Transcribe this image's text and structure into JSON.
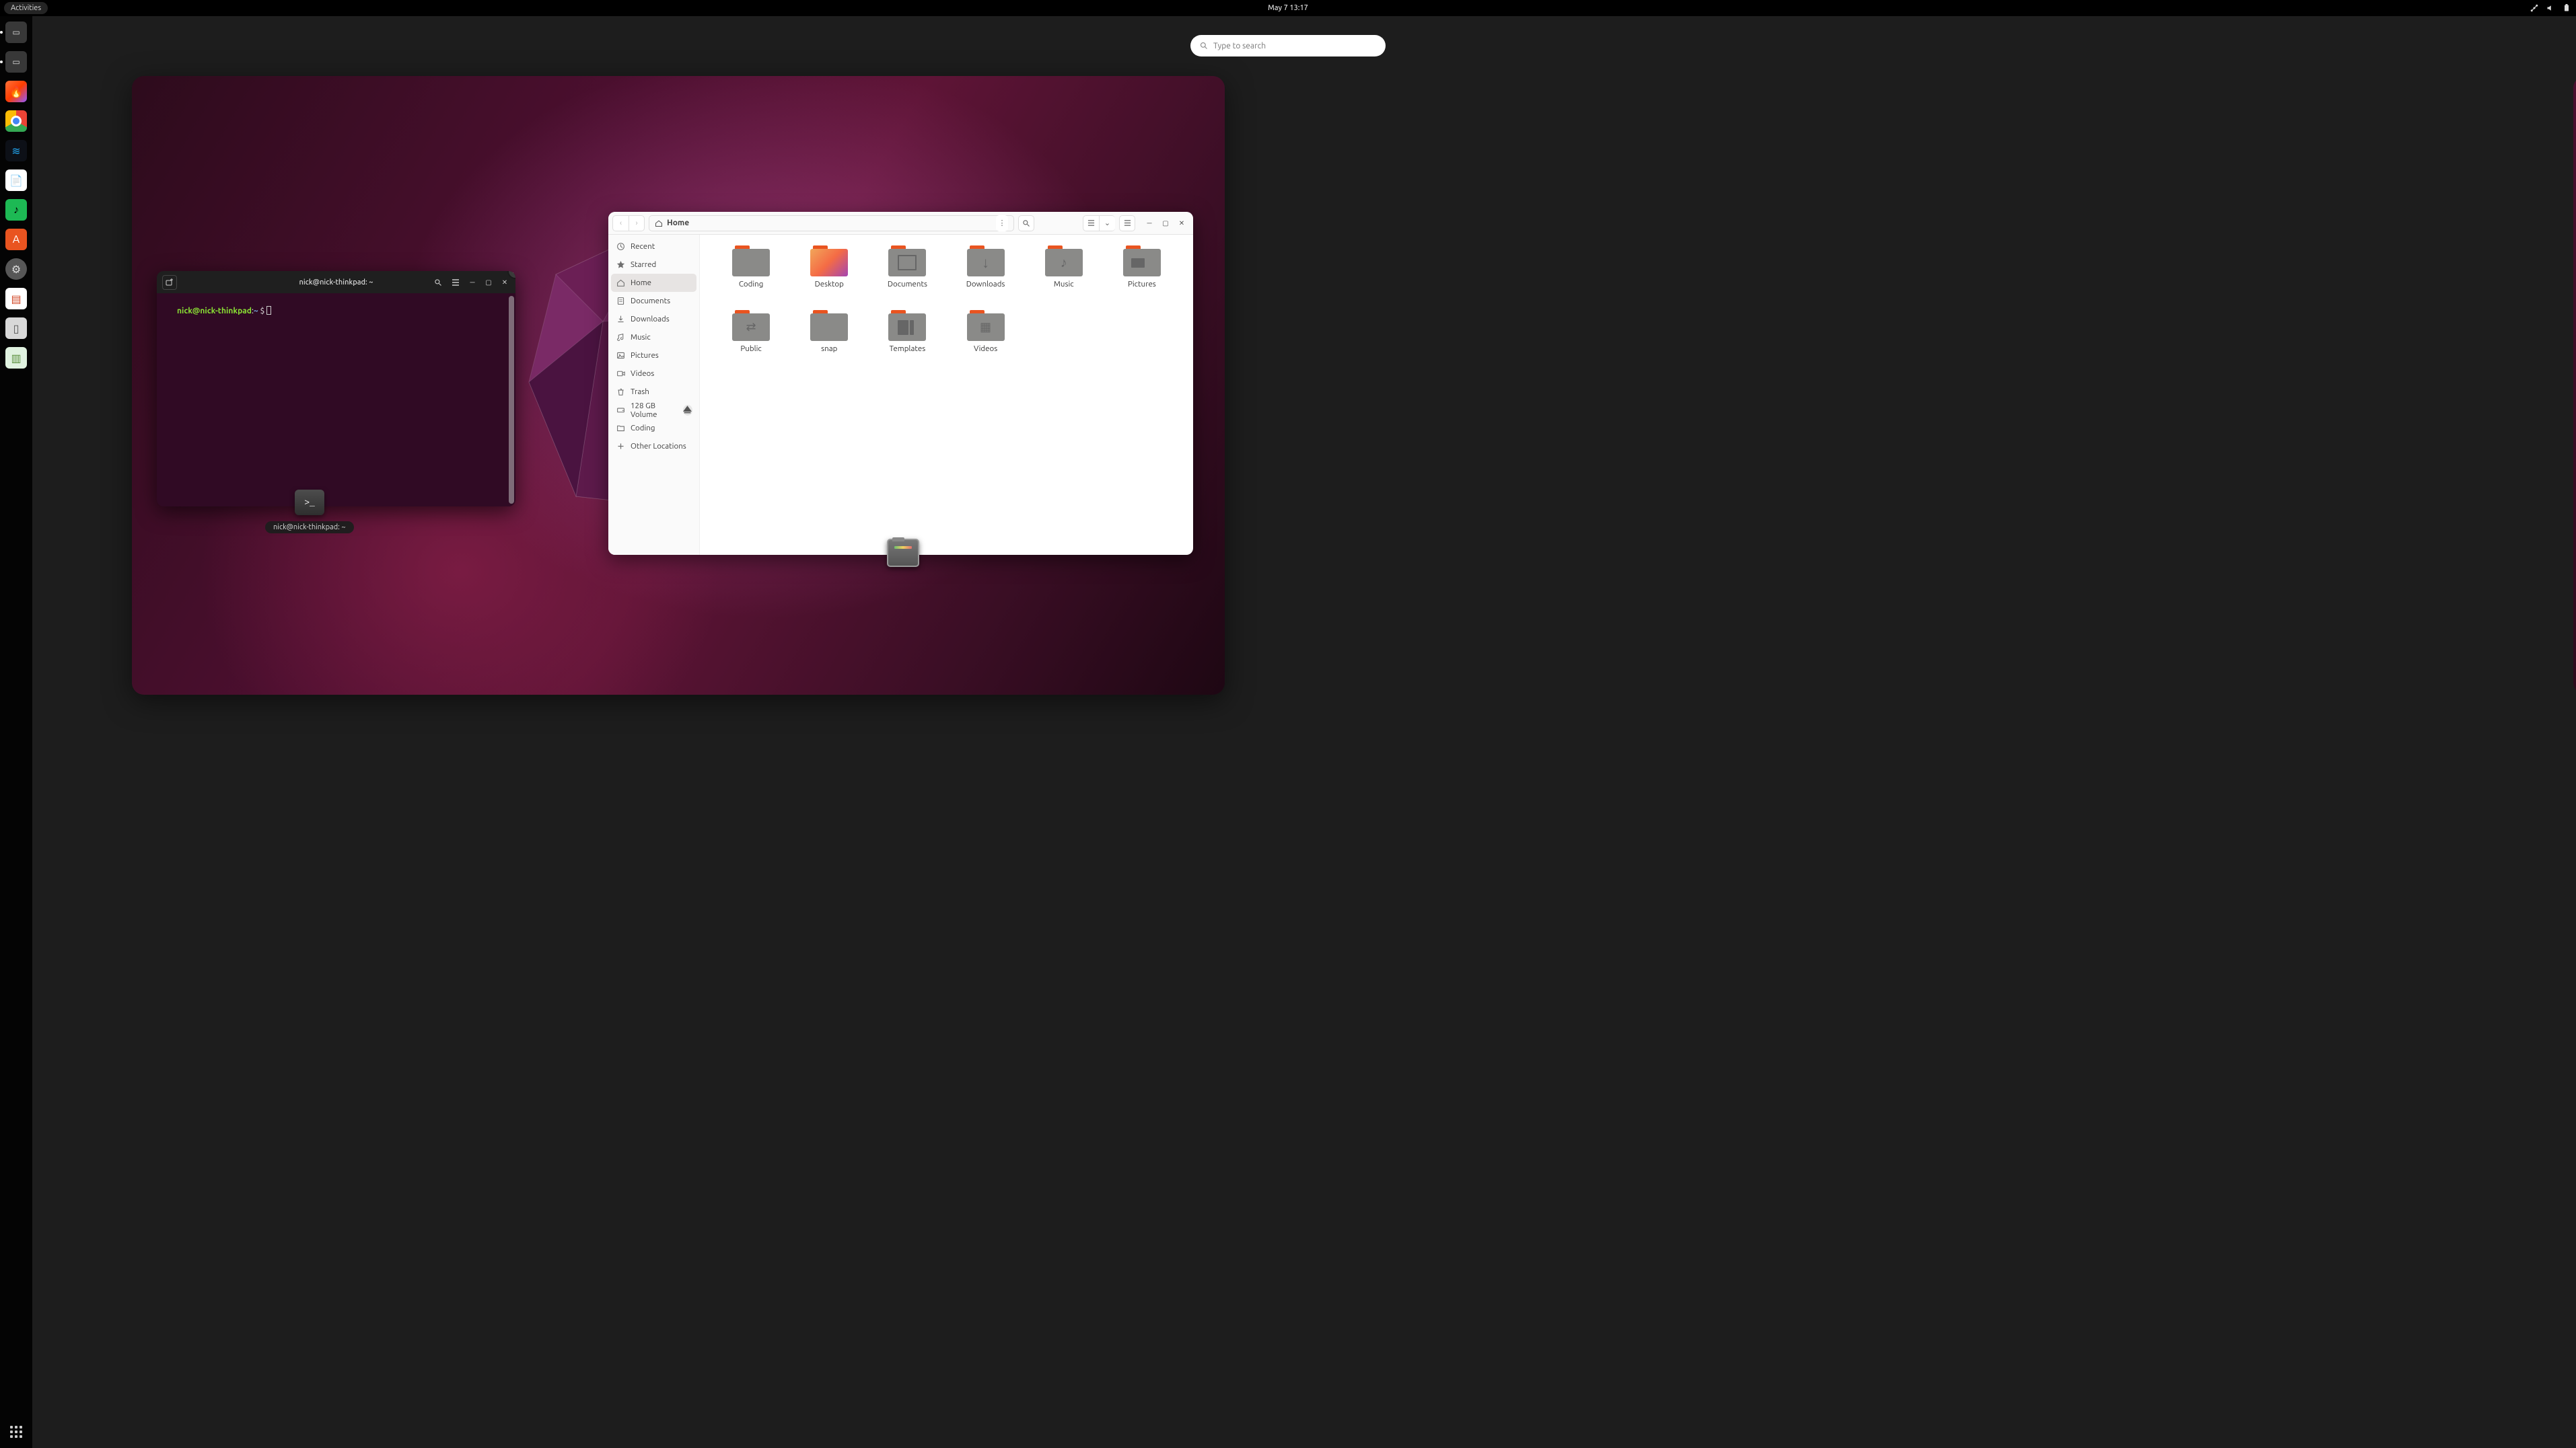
{
  "topbar": {
    "activities": "Activities",
    "datetime": "May 7  13:17"
  },
  "search": {
    "placeholder": "Type to search"
  },
  "dock": {
    "apps": [
      {
        "name": "thumb-terminal",
        "interactable": true
      },
      {
        "name": "thumb-files",
        "interactable": true
      },
      {
        "name": "firefox",
        "interactable": true
      },
      {
        "name": "chrome",
        "interactable": true
      },
      {
        "name": "vscode",
        "interactable": true
      },
      {
        "name": "libreoffice-writer",
        "interactable": true
      },
      {
        "name": "spotify",
        "interactable": true
      },
      {
        "name": "ubuntu-software",
        "interactable": true
      },
      {
        "name": "settings",
        "interactable": true
      },
      {
        "name": "wps",
        "interactable": true
      },
      {
        "name": "usb-drive",
        "interactable": true
      },
      {
        "name": "archive-manager",
        "interactable": true
      }
    ]
  },
  "terminal": {
    "title": "nick@nick-thinkpad: ~",
    "prompt_user": "nick@nick-thinkpad",
    "prompt_sep": ":",
    "prompt_path": "~",
    "prompt_symbol": "$",
    "overview_label": "nick@nick-thinkpad: ~"
  },
  "files": {
    "path_label": "Home",
    "sidebar": [
      {
        "icon": "clock",
        "label": "Recent"
      },
      {
        "icon": "star",
        "label": "Starred"
      },
      {
        "icon": "home",
        "label": "Home",
        "selected": true
      },
      {
        "icon": "doc",
        "label": "Documents"
      },
      {
        "icon": "down",
        "label": "Downloads"
      },
      {
        "icon": "music",
        "label": "Music"
      },
      {
        "icon": "pic",
        "label": "Pictures"
      },
      {
        "icon": "vid",
        "label": "Videos"
      },
      {
        "icon": "trash",
        "label": "Trash"
      },
      {
        "icon": "drive",
        "label": "128 GB Volume",
        "eject": true
      },
      {
        "icon": "folder",
        "label": "Coding"
      },
      {
        "icon": "plus",
        "label": "Other Locations"
      }
    ],
    "folders": [
      {
        "name": "Coding",
        "variant": "plain"
      },
      {
        "name": "Desktop",
        "variant": "desktop"
      },
      {
        "name": "Documents",
        "variant": "doc"
      },
      {
        "name": "Downloads",
        "variant": "down"
      },
      {
        "name": "Music",
        "variant": "music"
      },
      {
        "name": "Pictures",
        "variant": "pic"
      },
      {
        "name": "Public",
        "variant": "pub"
      },
      {
        "name": "snap",
        "variant": "plain"
      },
      {
        "name": "Templates",
        "variant": "tmpl"
      },
      {
        "name": "Videos",
        "variant": "vid"
      }
    ]
  }
}
